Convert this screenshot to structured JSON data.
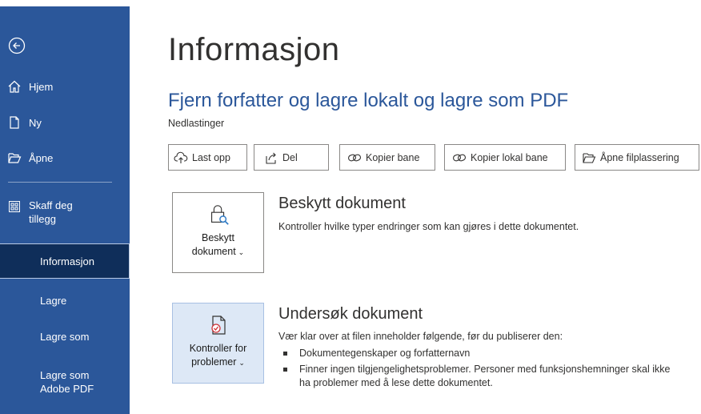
{
  "sidebar": {
    "back_label": "",
    "items": [
      {
        "label": "Hjem",
        "icon": "home-icon"
      },
      {
        "label": "Ny",
        "icon": "new-document-icon"
      },
      {
        "label": "Åpne",
        "icon": "folder-open-icon"
      },
      {
        "label": "Skaff deg tillegg",
        "icon": "addins-icon"
      },
      {
        "label": "Informasjon"
      },
      {
        "label": "Lagre"
      },
      {
        "label": "Lagre som"
      },
      {
        "label": "Lagre som Adobe PDF"
      }
    ],
    "active": "Informasjon"
  },
  "main": {
    "title": "Informasjon",
    "doc_title": "Fjern forfatter og lagre lokalt og lagre som PDF",
    "doc_path": "Nedlastinger",
    "actions": [
      {
        "label": "Last opp",
        "icon": "upload-cloud-icon"
      },
      {
        "label": "Del",
        "icon": "share-icon"
      },
      {
        "label": "Kopier bane",
        "icon": "link-icon"
      },
      {
        "label": "Kopier lokal bane",
        "icon": "link-icon"
      },
      {
        "label": "Åpne filplassering",
        "icon": "folder-open-icon"
      }
    ],
    "protect": {
      "button_line1": "Beskytt",
      "button_line2": "dokument",
      "title": "Beskytt dokument",
      "description": "Kontroller hvilke typer endringer som kan gjøres i dette dokumentet."
    },
    "inspect": {
      "button_line1": "Kontroller for",
      "button_line2": "problemer",
      "title": "Undersøk dokument",
      "description": "Vær klar over at filen inneholder følgende, før du publiserer den:",
      "bullets": [
        "Dokumentegenskaper og forfatternavn",
        "Finner ingen tilgjengelighetsproblemer. Personer med funksjonshemninger skal ikke ha problemer med å lese dette dokumentet."
      ]
    }
  },
  "colors": {
    "sidebar": "#2b579a",
    "active": "#0f2e5a",
    "accent": "#2b579a"
  }
}
